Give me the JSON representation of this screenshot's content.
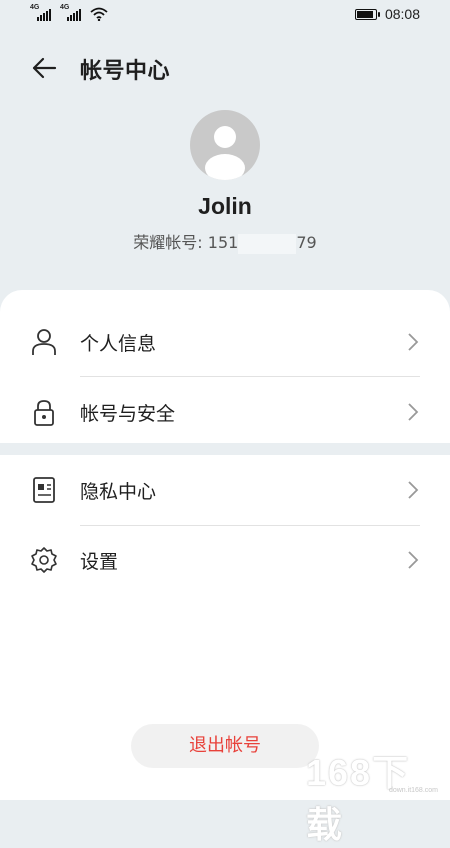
{
  "status_bar": {
    "network_1": "4G",
    "network_2": "4G",
    "time": "08:08",
    "icons": [
      "signal-icon",
      "signal-icon",
      "wifi-icon",
      "battery-icon"
    ]
  },
  "header": {
    "title": "帐号中心",
    "back_icon": "arrow-left-icon"
  },
  "profile": {
    "name": "Jolin",
    "account_label": "荣耀帐号:",
    "account_prefix": "151",
    "account_suffix": "79"
  },
  "menu": {
    "items": [
      {
        "label": "个人信息",
        "icon": "person-icon"
      },
      {
        "label": "帐号与安全",
        "icon": "lock-icon"
      },
      {
        "label": "隐私中心",
        "icon": "id-card-icon"
      },
      {
        "label": "设置",
        "icon": "gear-icon"
      }
    ],
    "chevron_icon": "chevron-right-icon"
  },
  "logout": {
    "label": "退出帐号"
  },
  "watermark": {
    "text": "168下载",
    "sub": "down.it168.com"
  },
  "colors": {
    "background": "#e9eef1",
    "card": "#ffffff",
    "logout_text": "#e8413a",
    "logout_bg": "#f1f1f1"
  }
}
